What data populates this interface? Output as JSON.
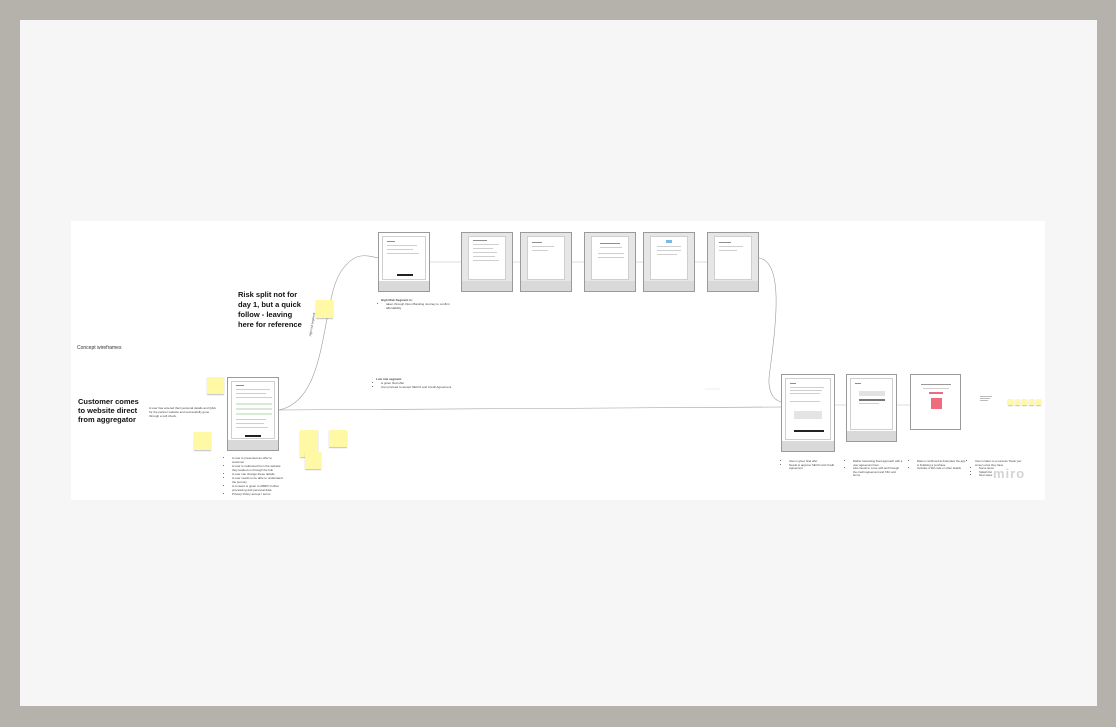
{
  "board": {
    "concept_label": "Concept wireframes",
    "customer_heading": "Customer comes to website direct from aggregator",
    "customer_desc": "A user has entered their personal details and Q&A for the partner website and successfully gone through a soft check.",
    "risk_heading": "Risk split not for day 1, but a quick follow - leaving here for reference",
    "high_risk_path_label": "High risk segment",
    "high_risk": {
      "title": "High Risk Segment is:",
      "items": [
        "taken through Open Banking Journey to confirm affordability"
      ]
    },
    "low_risk": {
      "title": "Low risk segment",
      "items": [
        "is given final offer",
        "Can proceed to accept SECCI and Credit Agreement"
      ]
    },
    "first_frame_notes": [
      "A user is presented an offer to customer",
      "A user is redirected from the website they landed on through the link",
      "A user can change these details",
      "A user needs to be able to understand the journey",
      "A consent is given to MMPC further processing and personal data",
      "Privacy Policy accept / terms"
    ],
    "end_notes": [
      [
        "User is given final offer",
        "Needs to approve SECCI and Credit Agreement"
      ],
      [
        "Rather interesting fixed approach with a user agreement here",
        "Also needs to move with and through the credit agreement and T&C and terms"
      ],
      [
        "Rate is confirmed at final place the app is finalising a purchase",
        "Includes a SM code or other details"
      ],
      [
        "User is taken to a success 'thank you' screen once they have",
        "Some items",
        "Splash list",
        "Next steps"
      ]
    ],
    "logo_text": "miro"
  }
}
